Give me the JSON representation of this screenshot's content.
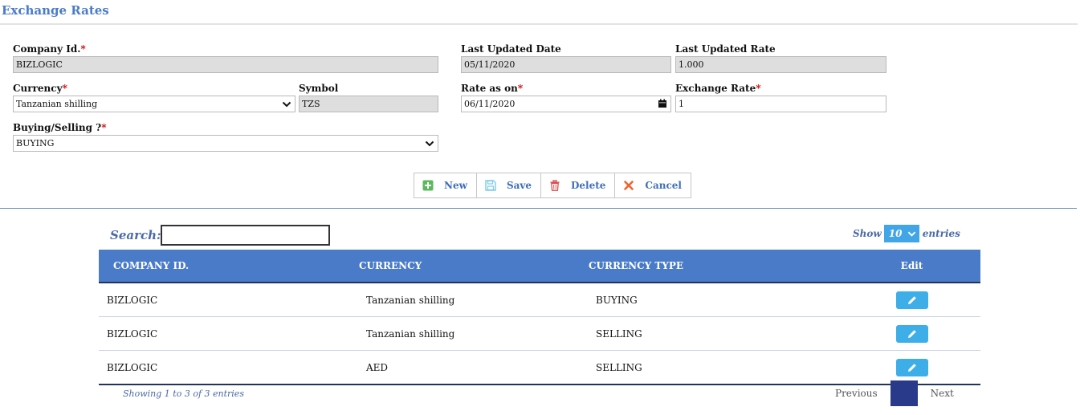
{
  "page_title": "Exchange Rates",
  "form": {
    "company_id": {
      "label": "Company Id.",
      "required": "*",
      "value": "BIZLOGIC"
    },
    "last_updated_date": {
      "label": "Last Updated Date",
      "value": "05/11/2020"
    },
    "last_updated_rate": {
      "label": "Last Updated Rate",
      "value": "1.000"
    },
    "currency": {
      "label": "Currency",
      "required": "*",
      "value": "Tanzanian shilling"
    },
    "symbol": {
      "label": "Symbol",
      "value": "TZS"
    },
    "rate_as_on": {
      "label": "Rate as on",
      "required": "*",
      "value": "06/11/2020"
    },
    "exchange_rate": {
      "label": "Exchange Rate",
      "required": "*",
      "value": "1"
    },
    "buying_selling": {
      "label": "Buying/Selling ?",
      "required": "*",
      "value": "BUYING"
    }
  },
  "toolbar": {
    "new_label": "New",
    "save_label": "Save",
    "delete_label": "Delete",
    "cancel_label": "Cancel"
  },
  "search": {
    "label": "Search:",
    "value": ""
  },
  "length": {
    "show": "Show",
    "value": "10",
    "entries": "entries"
  },
  "table": {
    "columns": [
      "COMPANY ID.",
      "CURRENCY",
      "CURRENCY TYPE",
      "Edit"
    ],
    "rows": [
      [
        "BIZLOGIC",
        "Tanzanian shilling",
        "BUYING"
      ],
      [
        "BIZLOGIC",
        "Tanzanian shilling",
        "SELLING"
      ],
      [
        "BIZLOGIC",
        "AED",
        "SELLING"
      ]
    ]
  },
  "info": "Showing 1 to 3 of 3 entries",
  "pagination": {
    "previous": "Previous",
    "current": "1",
    "next": "Next"
  },
  "colors": {
    "accent": "#4a7bc8",
    "edit_button": "#3eaee9",
    "required": "#d00000"
  },
  "icons": {
    "new": "plus-square-icon",
    "save": "floppy-disk-icon",
    "delete": "trash-icon",
    "cancel": "close-icon",
    "edit": "pencil-icon",
    "calendar": "calendar-icon",
    "dropdown": "chevron-down-icon"
  }
}
